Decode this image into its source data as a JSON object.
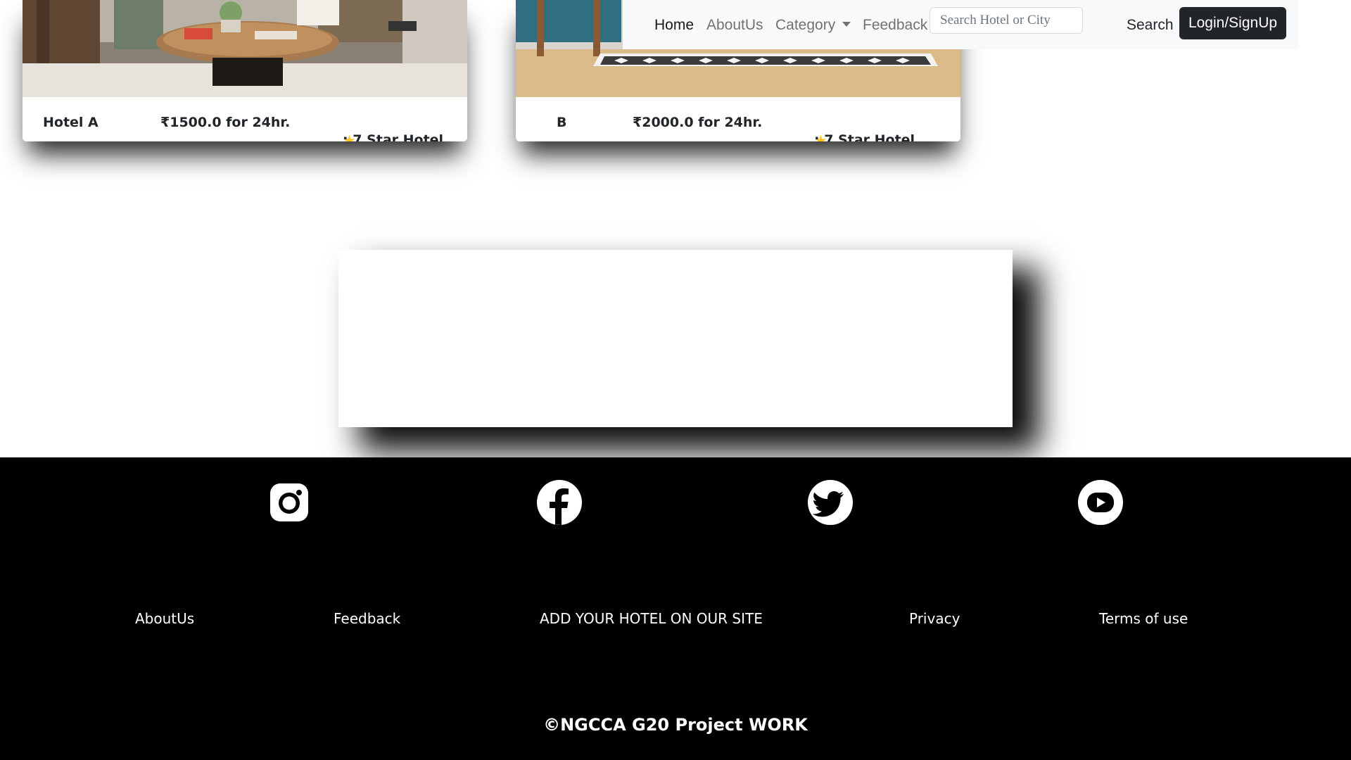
{
  "hotels": [
    {
      "name": "Hotel A",
      "price": "₹1500.0 for 24hr.",
      "rating_icon": "star-icon",
      "rating": ": 7 Star Hotel"
    },
    {
      "name": "B",
      "price": "₹2000.0 for 24hr.",
      "rating_icon": "star-icon",
      "rating": ": 7 Star Hotel"
    }
  ],
  "navbar": {
    "home": "Home",
    "about": "AboutUs",
    "category": "Category",
    "feedback": "Feedback",
    "search_placeholder": "Search Hotel or City",
    "search_button": "Search",
    "login_button": "Login/SignUp"
  },
  "footer": {
    "social": [
      "instagram-icon",
      "facebook-icon",
      "twitter-icon",
      "youtube-icon"
    ],
    "links": {
      "about": "AboutUs",
      "feedback": "Feedback",
      "add_hotel": "ADD YOUR HOTEL ON OUR SITE",
      "privacy": "Privacy",
      "terms": "Terms of use"
    },
    "copyright": "©NGCCA G20 Project WORK"
  },
  "colors": {
    "navbar_bg": "#f8f9fa",
    "login_button_bg": "#212529",
    "footer_bg": "#000000",
    "star": "#ffc61a"
  }
}
